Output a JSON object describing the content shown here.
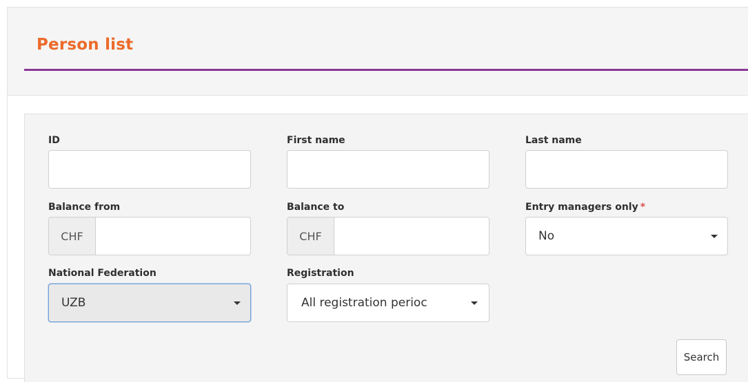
{
  "page": {
    "title": "Person list"
  },
  "form": {
    "id": {
      "label": "ID",
      "value": ""
    },
    "first_name": {
      "label": "First name",
      "value": ""
    },
    "last_name": {
      "label": "Last name",
      "value": ""
    },
    "balance_from": {
      "label": "Balance from",
      "currency": "CHF",
      "value": ""
    },
    "balance_to": {
      "label": "Balance to",
      "currency": "CHF",
      "value": ""
    },
    "entry_managers_only": {
      "label": "Entry managers only",
      "required_marker": "*",
      "value": "No"
    },
    "national_federation": {
      "label": "National Federation",
      "value": "UZB"
    },
    "registration": {
      "label": "Registration",
      "value": "All registration perioc"
    },
    "search_button": "Search"
  },
  "colors": {
    "title": "#ec6a2a",
    "title_rule": "#8b3596",
    "required": "#d9534f",
    "focus_border": "#6f9ed8"
  },
  "icons": {
    "dropdown": "caret-down-icon"
  }
}
